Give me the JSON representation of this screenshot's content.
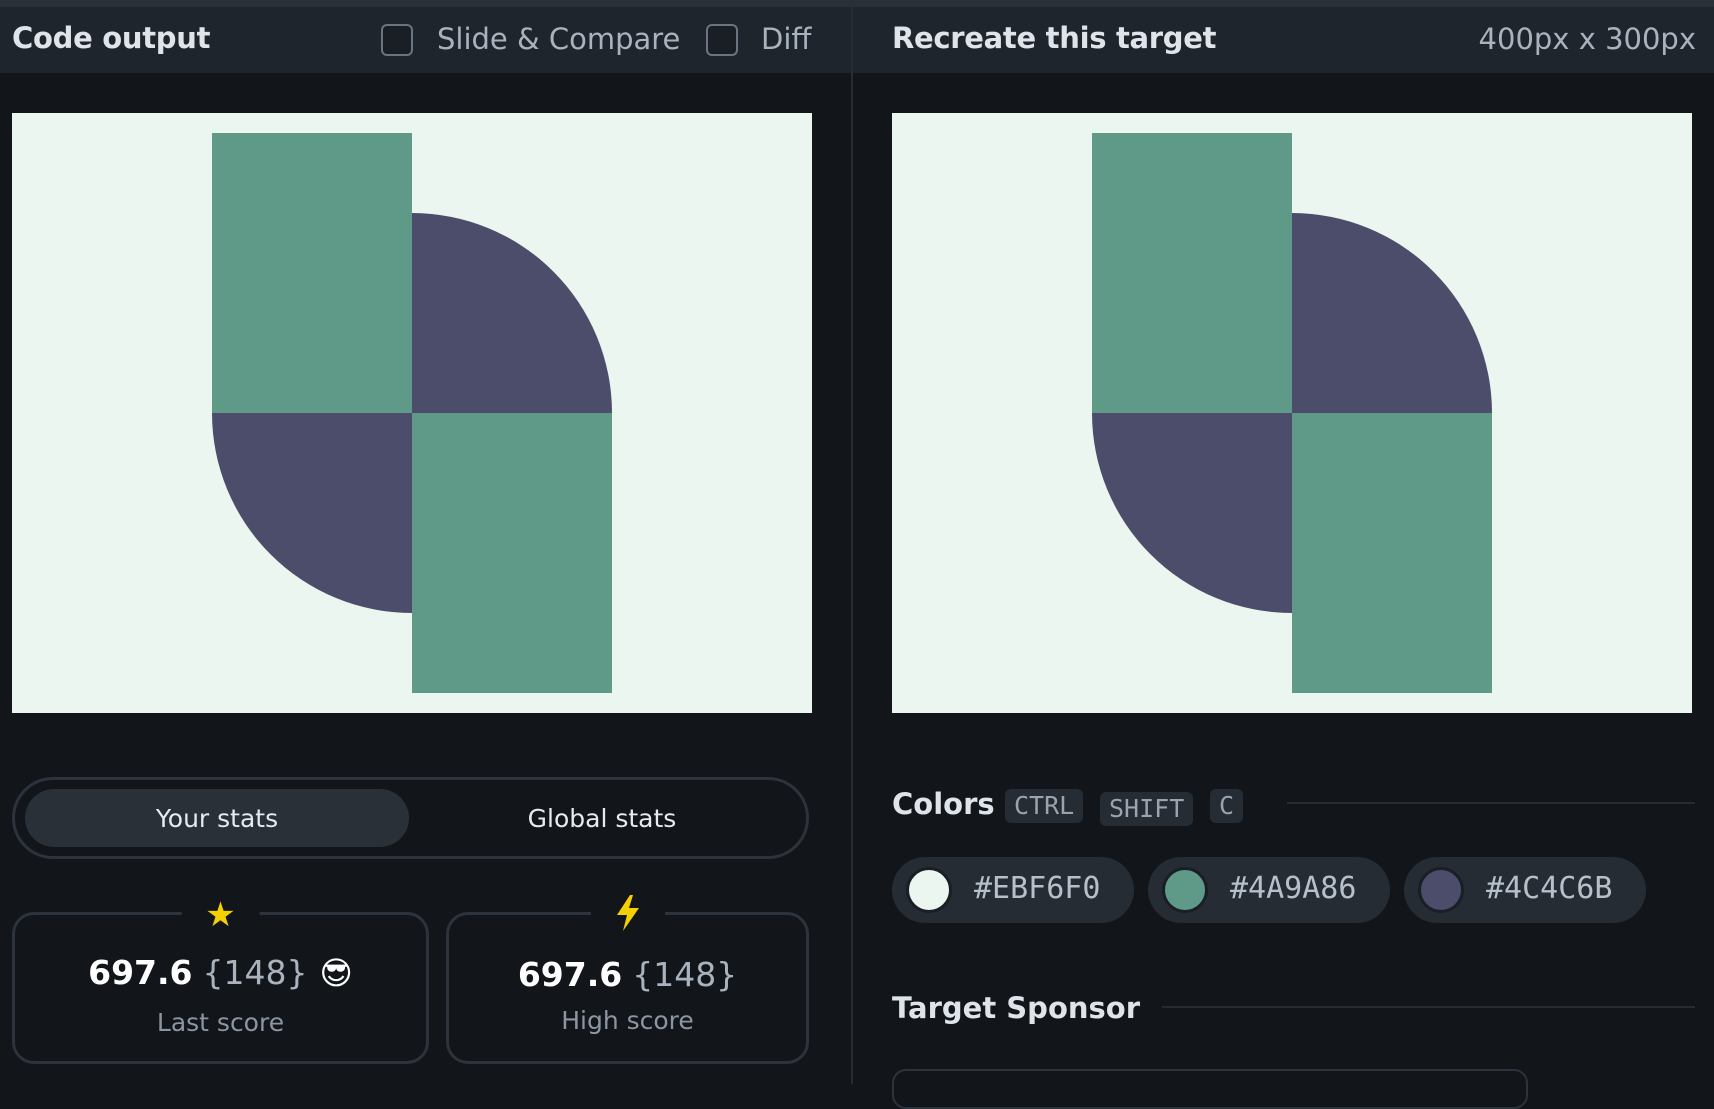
{
  "left_header": {
    "title": "Code output",
    "slide_compare_label": "Slide & Compare",
    "diff_label": "Diff"
  },
  "right_header": {
    "title": "Recreate this target",
    "dimensions": "400px x 300px"
  },
  "stats": {
    "tabs": [
      "Your stats",
      "Global stats"
    ],
    "active_tab": "Your stats",
    "last_score": {
      "icon": "star-icon",
      "score": "697.6",
      "count": "{148}",
      "emoji": "😎",
      "label": "Last score"
    },
    "high_score": {
      "icon": "lightning-icon",
      "score": "697.6",
      "count": "{148}",
      "label": "High score"
    }
  },
  "colors": {
    "title": "Colors",
    "shortcut": [
      "CTRL",
      "SHIFT",
      "C"
    ],
    "swatches": [
      {
        "hex": "#EBF6F0",
        "color": "#ebf6f0"
      },
      {
        "hex": "#4A9A86",
        "color": "#5e9a87"
      },
      {
        "hex": "#4C4C6B",
        "color": "#4c4c6b"
      }
    ]
  },
  "sponsor": {
    "title": "Target Sponsor"
  },
  "theme": {
    "background": "#ebf6f0",
    "green": "#5e9a87",
    "purple": "#4c4c6b"
  }
}
